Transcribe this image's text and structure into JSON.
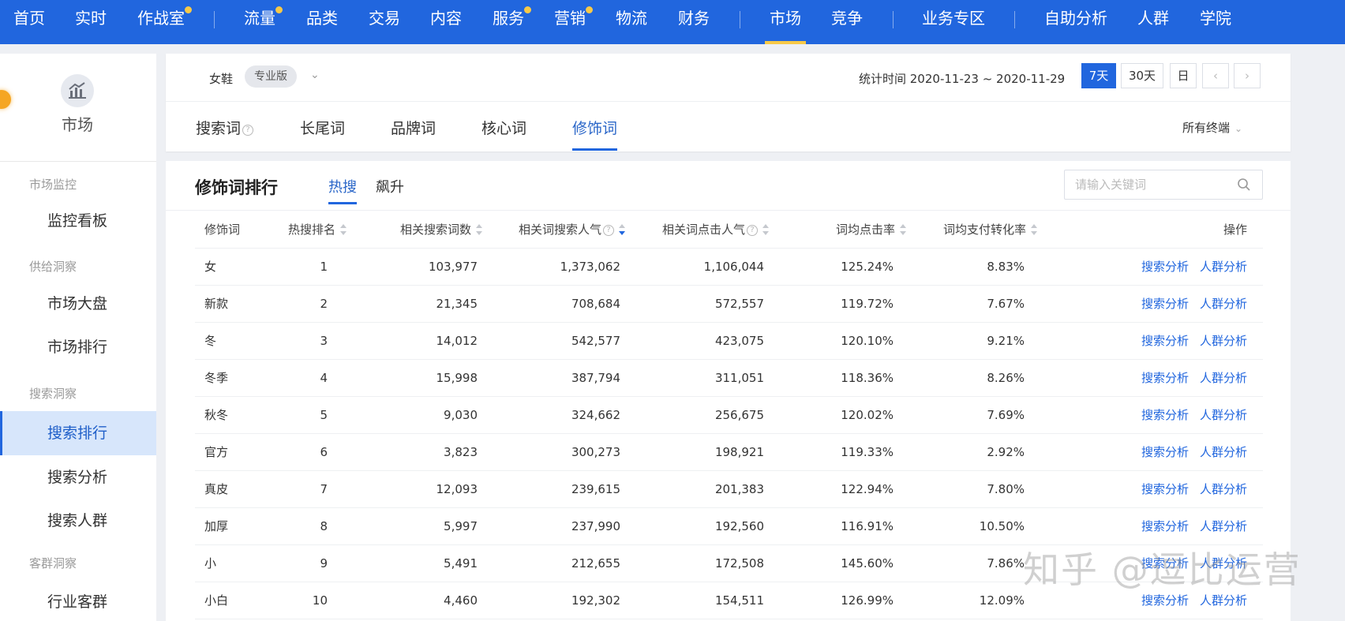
{
  "nav": {
    "items": [
      {
        "label": "首页",
        "dot": false
      },
      {
        "label": "实时",
        "dot": false
      },
      {
        "label": "作战室",
        "dot": true
      },
      {
        "label": "流量",
        "dot": true
      },
      {
        "label": "品类",
        "dot": false
      },
      {
        "label": "交易",
        "dot": false
      },
      {
        "label": "内容",
        "dot": false
      },
      {
        "label": "服务",
        "dot": true
      },
      {
        "label": "营销",
        "dot": true
      },
      {
        "label": "物流",
        "dot": false
      },
      {
        "label": "财务",
        "dot": false
      },
      {
        "label": "市场",
        "dot": false,
        "active": true
      },
      {
        "label": "竞争",
        "dot": false
      },
      {
        "label": "业务专区",
        "dot": false
      },
      {
        "label": "自助分析",
        "dot": false
      },
      {
        "label": "人群",
        "dot": false
      },
      {
        "label": "学院",
        "dot": false
      }
    ]
  },
  "sidebar": {
    "title": "市场",
    "icon": "market-chart-icon",
    "groups": [
      {
        "label": "市场监控",
        "items": [
          "监控看板"
        ]
      },
      {
        "label": "供给洞察",
        "items": [
          "市场大盘",
          "市场排行"
        ]
      },
      {
        "label": "搜索洞察",
        "items": [
          "搜索排行",
          "搜索分析",
          "搜索人群"
        ]
      },
      {
        "label": "客群洞察",
        "items": [
          "行业客群"
        ]
      }
    ],
    "active_item": "搜索排行"
  },
  "filter": {
    "category": "女鞋",
    "edition": "专业版",
    "stat_time": "统计时间 2020-11-23 ~ 2020-11-29",
    "range_buttons": [
      "7天",
      "30天",
      "日"
    ],
    "active_range": "7天",
    "terminal": "所有终端"
  },
  "tabs": [
    "搜索词",
    "长尾词",
    "品牌词",
    "核心词",
    "修饰词"
  ],
  "active_tab": "修饰词",
  "ranking": {
    "title": "修饰词排行",
    "subtabs": [
      "热搜",
      "飙升"
    ],
    "active_subtab": "热搜",
    "search_placeholder": "请输入关键词",
    "columns": [
      "修饰词",
      "热搜排名",
      "相关搜索词数",
      "相关词搜索人气",
      "相关词点击人气",
      "词均点击率",
      "词均支付转化率",
      "操作"
    ],
    "action_labels": [
      "搜索分析",
      "人群分析"
    ],
    "rows": [
      {
        "word": "女",
        "rank": "1",
        "related_count": "103,977",
        "search_pop": "1,373,062",
        "click_pop": "1,106,044",
        "ctr": "125.24%",
        "cvr": "8.83%"
      },
      {
        "word": "新款",
        "rank": "2",
        "related_count": "21,345",
        "search_pop": "708,684",
        "click_pop": "572,557",
        "ctr": "119.72%",
        "cvr": "7.67%"
      },
      {
        "word": "冬",
        "rank": "3",
        "related_count": "14,012",
        "search_pop": "542,577",
        "click_pop": "423,075",
        "ctr": "120.10%",
        "cvr": "9.21%"
      },
      {
        "word": "冬季",
        "rank": "4",
        "related_count": "15,998",
        "search_pop": "387,794",
        "click_pop": "311,051",
        "ctr": "118.36%",
        "cvr": "8.26%"
      },
      {
        "word": "秋冬",
        "rank": "5",
        "related_count": "9,030",
        "search_pop": "324,662",
        "click_pop": "256,675",
        "ctr": "120.02%",
        "cvr": "7.69%"
      },
      {
        "word": "官方",
        "rank": "6",
        "related_count": "3,823",
        "search_pop": "300,273",
        "click_pop": "198,921",
        "ctr": "119.33%",
        "cvr": "2.92%"
      },
      {
        "word": "真皮",
        "rank": "7",
        "related_count": "12,093",
        "search_pop": "239,615",
        "click_pop": "201,383",
        "ctr": "122.94%",
        "cvr": "7.80%"
      },
      {
        "word": "加厚",
        "rank": "8",
        "related_count": "5,997",
        "search_pop": "237,990",
        "click_pop": "192,560",
        "ctr": "116.91%",
        "cvr": "10.50%"
      },
      {
        "word": "小",
        "rank": "9",
        "related_count": "5,491",
        "search_pop": "212,655",
        "click_pop": "172,508",
        "ctr": "145.60%",
        "cvr": "7.86%"
      },
      {
        "word": "小白",
        "rank": "10",
        "related_count": "4,460",
        "search_pop": "192,302",
        "click_pop": "154,511",
        "ctr": "126.99%",
        "cvr": "12.09%"
      }
    ]
  },
  "watermark": "知乎 @逗比运营",
  "colors": {
    "brand": "#2166de",
    "accent_dot": "#f7c948",
    "link": "#2166de"
  }
}
